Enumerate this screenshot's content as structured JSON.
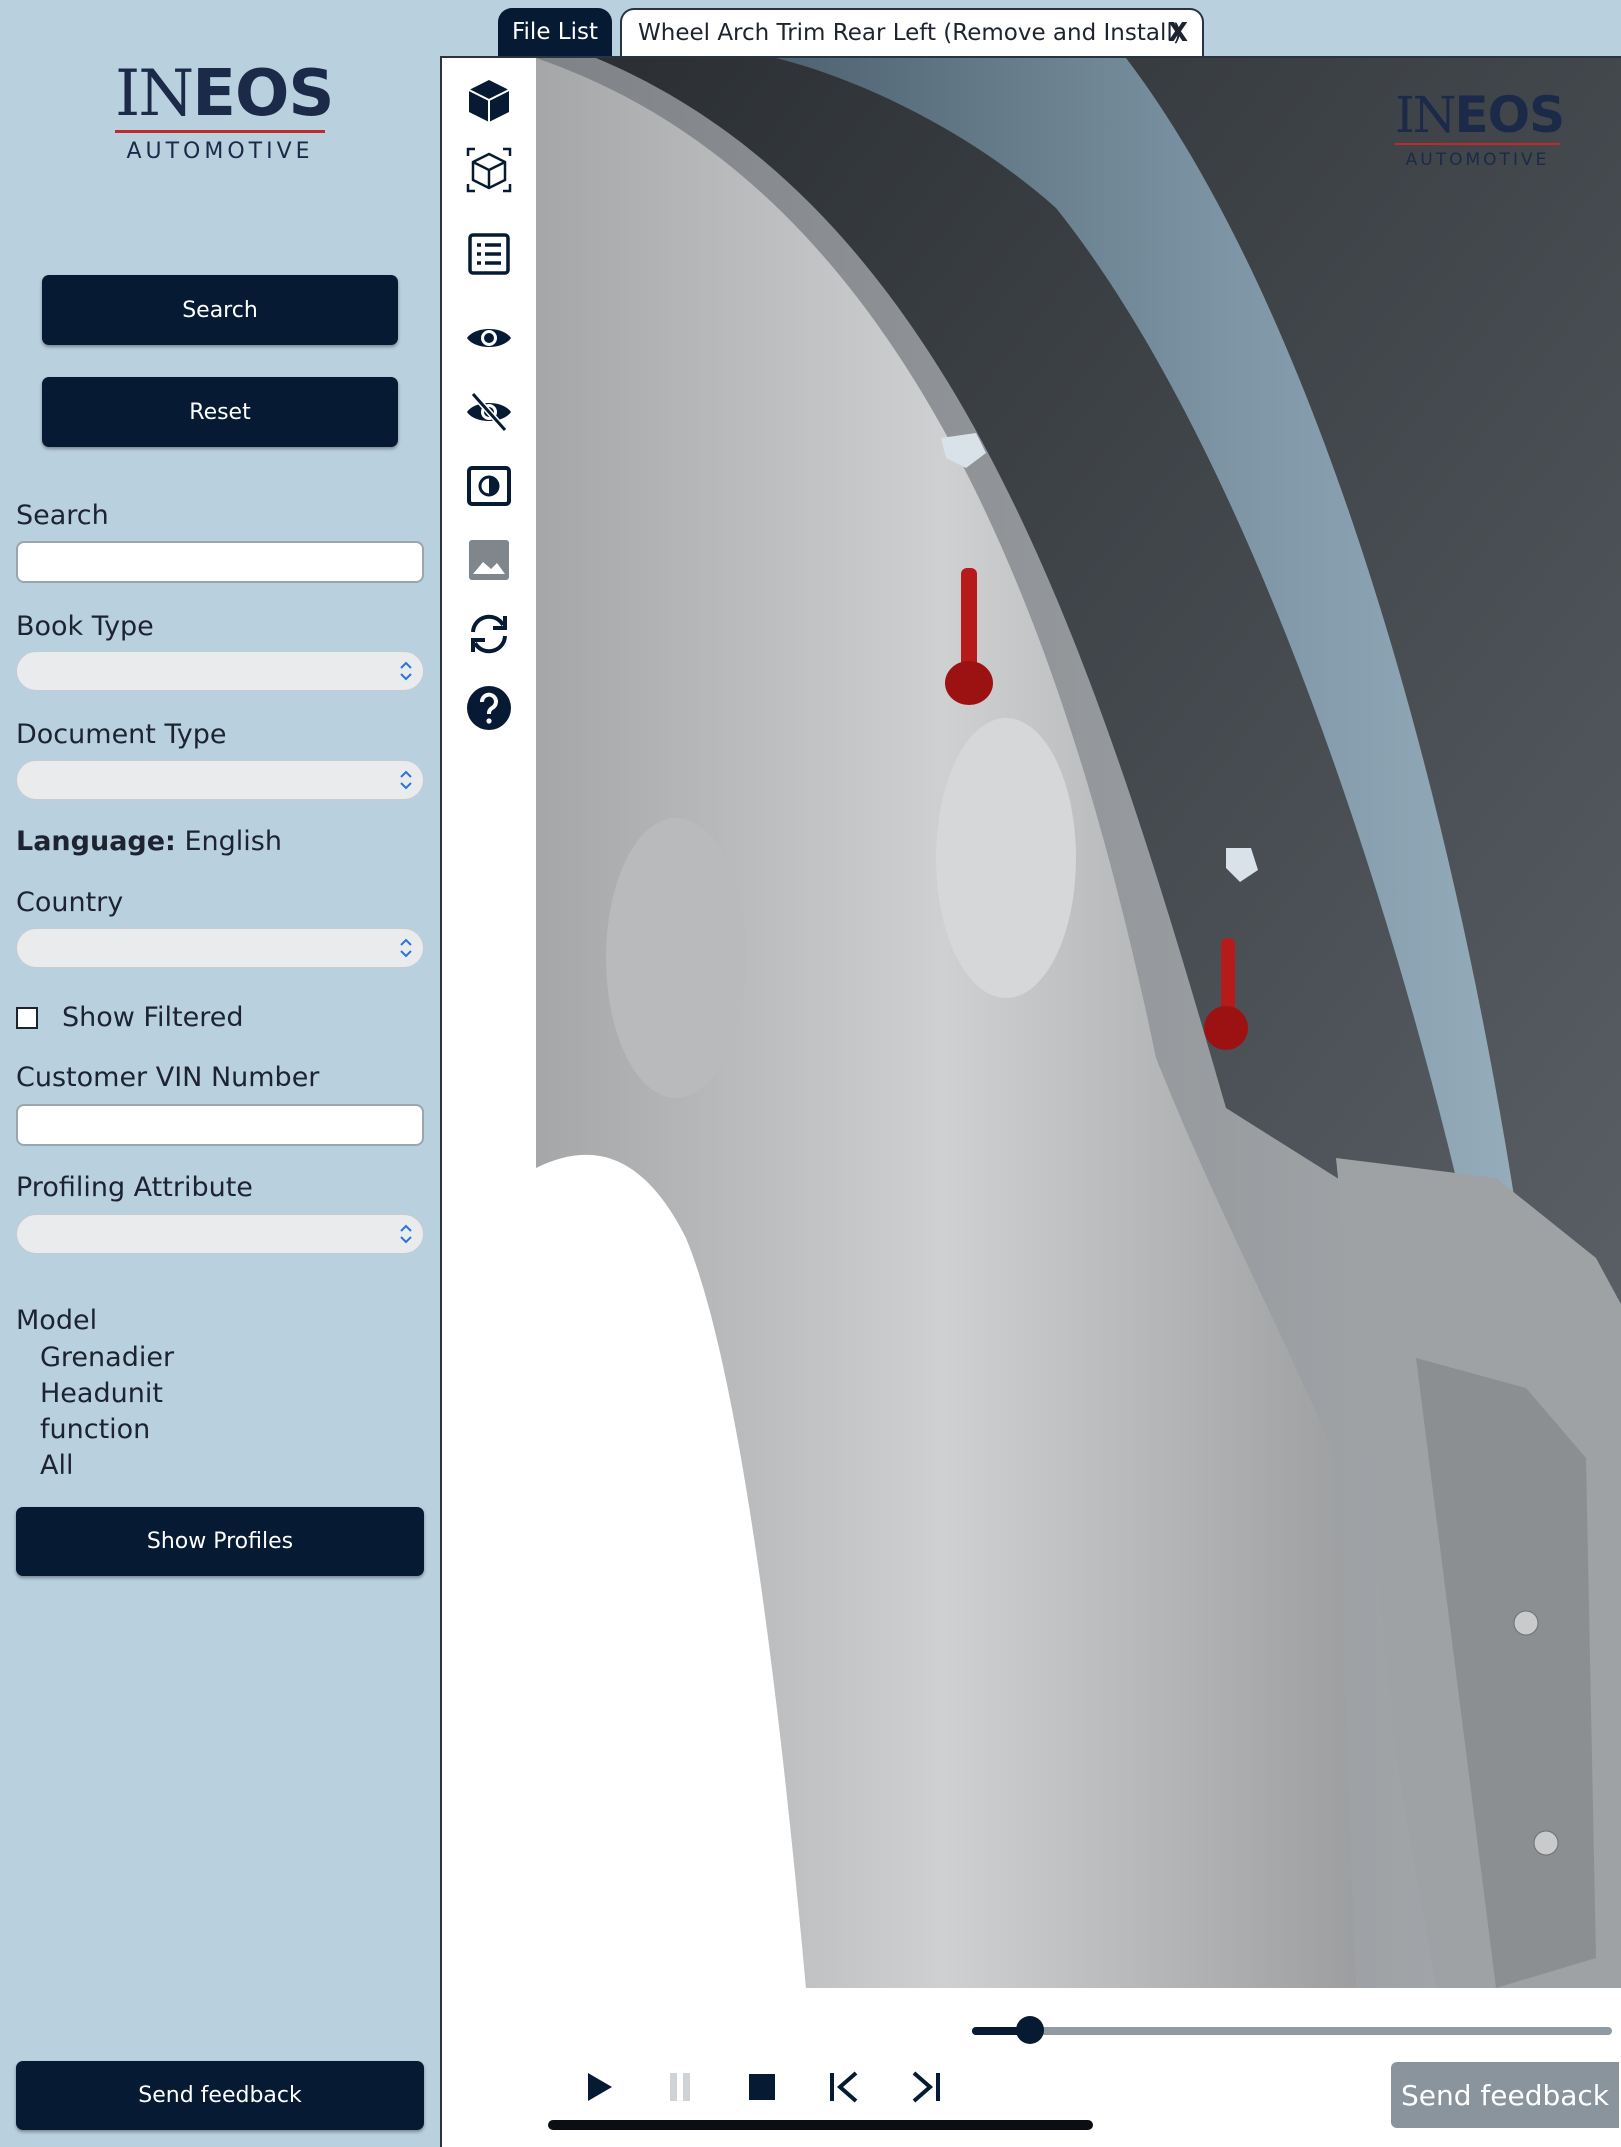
{
  "brand": {
    "name_left": "IN",
    "name_bold": "EOS",
    "subtitle": "AUTOMOTIVE",
    "accent_color": "#c02a2a",
    "navy": "#061a33"
  },
  "sidebar": {
    "search_button": "Search",
    "reset_button": "Reset",
    "search_label": "Search",
    "search_value": "",
    "book_type_label": "Book Type",
    "document_type_label": "Document Type",
    "language_label": "Language:",
    "language_value": "English",
    "country_label": "Country",
    "show_filtered_label": "Show Filtered",
    "show_filtered_checked": false,
    "vin_label": "Customer VIN Number",
    "vin_value": "",
    "profiling_label": "Profiling Attribute",
    "model_label": "Model",
    "model_items": [
      "Grenadier",
      "Headunit",
      "function",
      "All"
    ],
    "show_profiles_button": "Show  Profiles",
    "send_feedback_button": "Send feedback"
  },
  "tabs": {
    "file_list": "File List",
    "document": "Wheel Arch Trim Rear Left (Remove and Install)",
    "close": "X"
  },
  "toolbar_icons": [
    "solid-cube-icon",
    "wireframe-cube-icon",
    "list-icon",
    "eye-icon",
    "eye-slash-icon",
    "contrast-icon",
    "image-icon",
    "refresh-icon",
    "help-icon"
  ],
  "playback": {
    "progress": 0.09
  },
  "viewer": {
    "send_feedback_button": "Send feedback"
  }
}
